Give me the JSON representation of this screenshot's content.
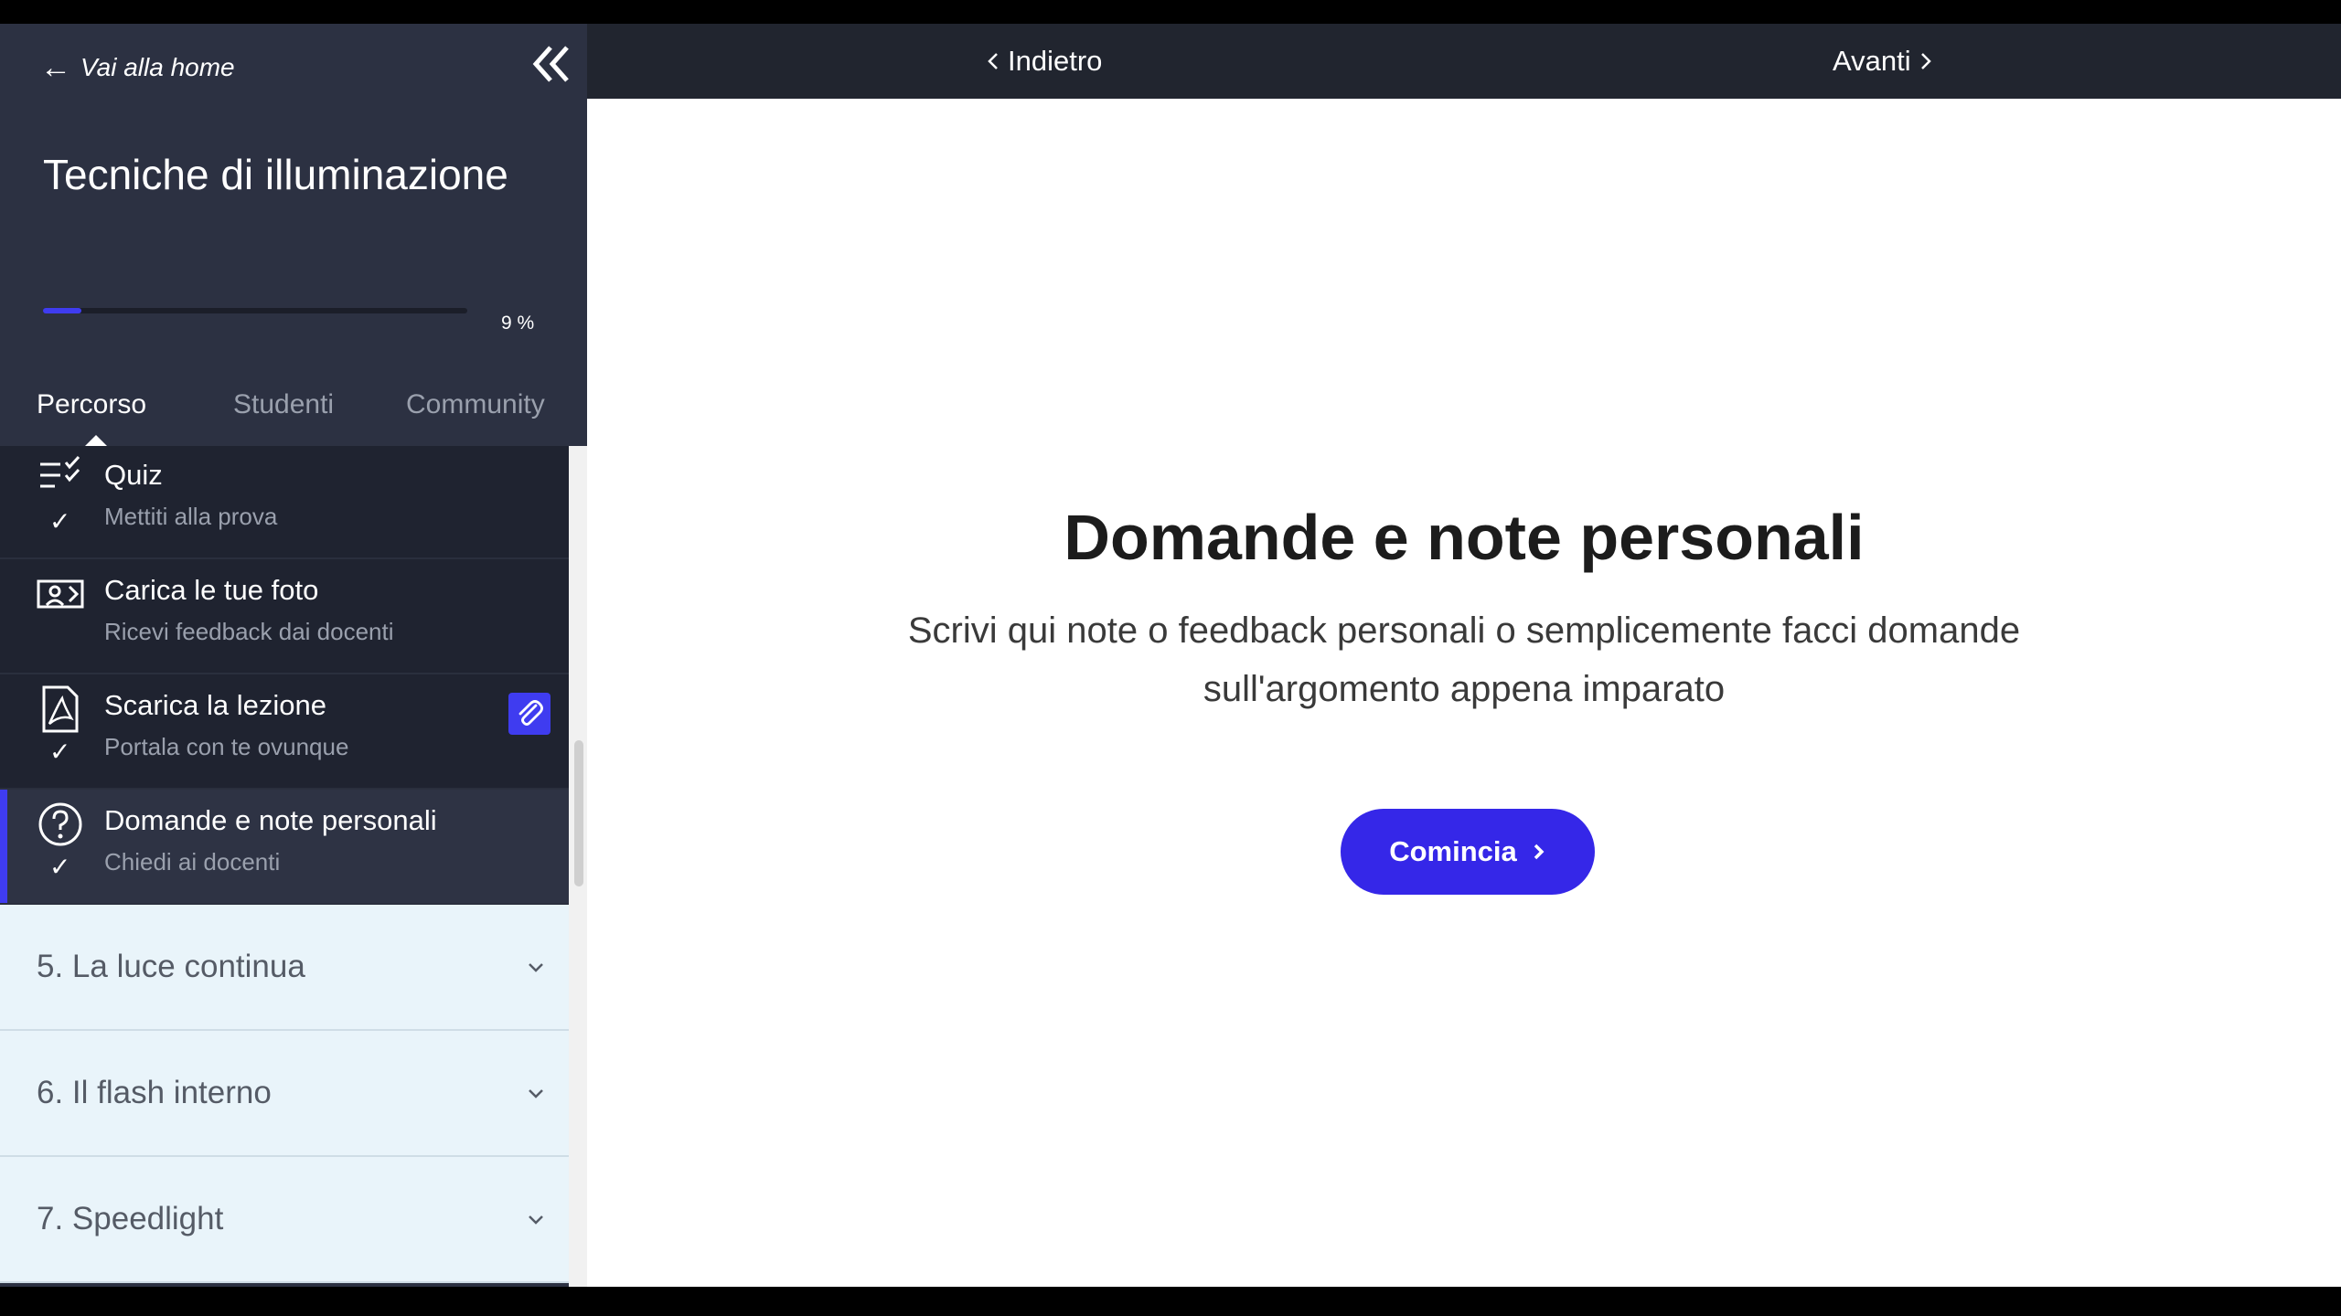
{
  "sidebar": {
    "back_link": "Vai alla home",
    "course_title": "Tecniche di illuminazione",
    "progress_percent": 9,
    "progress_label": "9 %",
    "tabs": [
      {
        "label": "Percorso",
        "active": true
      },
      {
        "label": "Studenti",
        "active": false
      },
      {
        "label": "Community",
        "active": false
      }
    ],
    "lessons": [
      {
        "title": "Quiz",
        "subtitle": "Mettiti alla prova",
        "icon": "checklist-icon",
        "completed": true
      },
      {
        "title": "Carica le tue foto",
        "subtitle": "Ricevi feedback dai docenti",
        "icon": "id-card-icon",
        "completed": false
      },
      {
        "title": "Scarica la lezione",
        "subtitle": "Portala con te ovunque",
        "icon": "pdf-icon",
        "completed": true,
        "attachment_icon": "paperclip-icon"
      },
      {
        "title": "Domande e note personali",
        "subtitle": "Chiedi ai docenti",
        "icon": "question-circle-icon",
        "completed": true,
        "active": true
      }
    ],
    "modules": [
      {
        "label": "5. La luce continua"
      },
      {
        "label": "6. Il flash interno"
      },
      {
        "label": "7. Speedlight"
      }
    ]
  },
  "topbar": {
    "prev_label": "Indietro",
    "next_label": "Avanti"
  },
  "main": {
    "title": "Domande e note personali",
    "description": "Scrivi qui note o feedback personali o semplicemente facci domande sull'argomento appena imparato",
    "start_button": "Comincia"
  },
  "colors": {
    "accent": "#3f3cf0",
    "sidebar_bg": "#2c3142",
    "topbar_bg": "#21252f",
    "module_bg": "#e9f4fa"
  }
}
